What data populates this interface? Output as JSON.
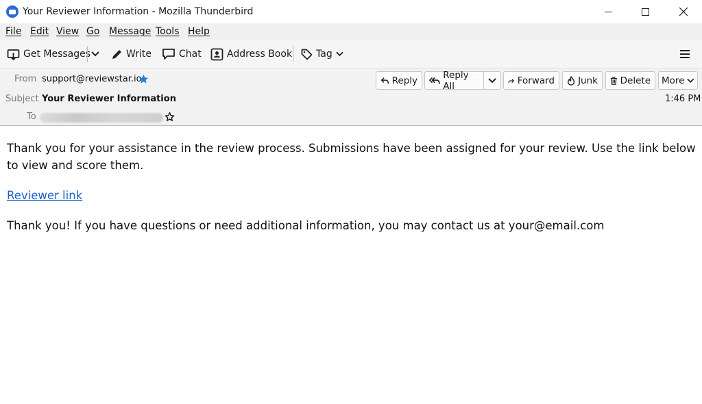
{
  "window": {
    "title": "Your Reviewer Information - Mozilla Thunderbird"
  },
  "menubar": {
    "items": [
      "File",
      "Edit",
      "View",
      "Go",
      "Message",
      "Tools",
      "Help"
    ]
  },
  "toolbar": {
    "get_messages": "Get Messages",
    "write": "Write",
    "chat": "Chat",
    "address_book": "Address Book",
    "tag": "Tag"
  },
  "header": {
    "from_label": "From",
    "from_value": "support@reviewstar.io",
    "subject_label": "Subject",
    "subject_value": "Your Reviewer Information",
    "to_label": "To",
    "time": "1:46 PM"
  },
  "message_actions": {
    "reply": "Reply",
    "reply_all": "Reply All",
    "forward": "Forward",
    "junk": "Junk",
    "delete": "Delete",
    "more": "More"
  },
  "body": {
    "paragraph1": "Thank you for your assistance in the review process. Submissions have been assigned for your review. Use the link below to view and score them.",
    "link_text": "Reviewer link",
    "paragraph2": "Thank you! If you have questions or need additional information, you may contact us at your@email.com"
  },
  "colors": {
    "link": "#1a62c9",
    "star_blue": "#1a7ee8",
    "app_icon": "#2a6ccf"
  },
  "icons": {
    "app": "thunderbird-icon",
    "get_messages": "inbox-download-icon",
    "write": "pencil-icon",
    "chat": "chat-bubble-icon",
    "address_book": "address-book-icon",
    "tag": "tag-icon",
    "menu": "hamburger-menu-icon"
  }
}
